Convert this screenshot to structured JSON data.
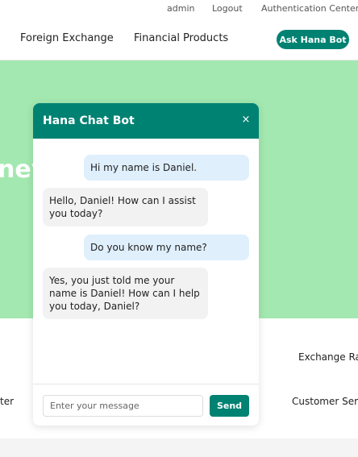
{
  "util_nav": {
    "admin": "admin",
    "logout": "Logout",
    "auth_center": "Authentication Center"
  },
  "main_nav": {
    "foreign_exchange": "Foreign Exchange",
    "financial_products": "Financial Products",
    "ask_button": "Ask Hana Bot"
  },
  "hero": {
    "heading_visible": "ney"
  },
  "quick_links": {
    "exchange_rate_partial": "Exchange Rat",
    "left_partial": "ter",
    "customer_service_partial": "Customer Serv"
  },
  "chat": {
    "title": "Hana Chat Bot",
    "close_symbol": "×",
    "messages": [
      {
        "sender": "user",
        "text": "Hi my name is Daniel."
      },
      {
        "sender": "bot",
        "text": "Hello, Daniel! How can I assist you today?"
      },
      {
        "sender": "user",
        "text": "Do you know my name?"
      },
      {
        "sender": "bot",
        "text": "Yes, you just told me your name is Daniel! How can I help you today, Daniel?"
      }
    ],
    "input_placeholder": "Enter your message",
    "send_label": "Send"
  },
  "colors": {
    "brand": "#008272",
    "hero_background": "#a3e8b0",
    "user_bubble": "#dfeffc",
    "bot_bubble": "#f2f2f2"
  }
}
